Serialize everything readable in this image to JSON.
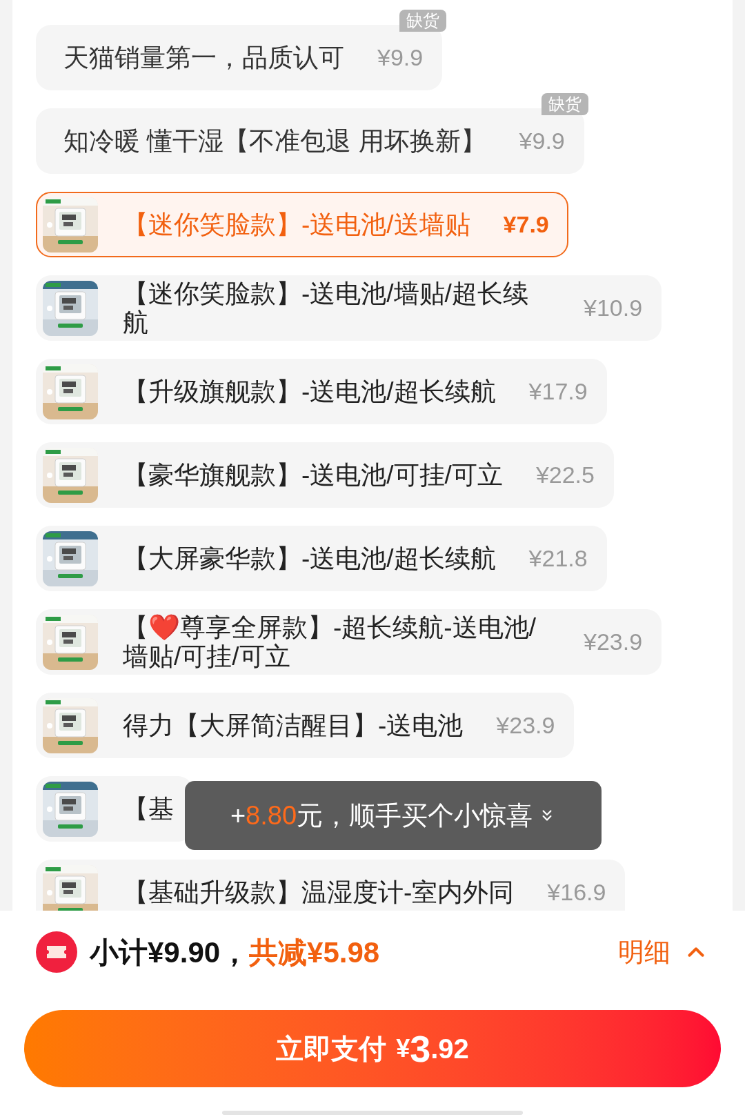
{
  "options": [
    {
      "kind": "text",
      "title": "天猫销量第一，品质认可",
      "price": "¥9.9",
      "selected": false,
      "out_of_stock": true,
      "badge": "缺货"
    },
    {
      "kind": "text",
      "title": "知冷暖 懂干湿【不准包退 用坏换新】",
      "price": "¥9.9",
      "selected": false,
      "out_of_stock": true,
      "badge": "缺货"
    },
    {
      "title": "【迷你笑脸款】-送电池/送墙贴",
      "price": "¥7.9",
      "selected": true,
      "out_of_stock": false
    },
    {
      "title": "【迷你笑脸款】-送电池/墙贴/超长续航",
      "price": "¥10.9",
      "selected": false,
      "out_of_stock": false
    },
    {
      "title": "【升级旗舰款】-送电池/超长续航",
      "price": "¥17.9",
      "selected": false,
      "out_of_stock": false
    },
    {
      "title": "【豪华旗舰款】-送电池/可挂/可立",
      "price": "¥22.5",
      "selected": false,
      "out_of_stock": false
    },
    {
      "title": "【大屏豪华款】-送电池/超长续航",
      "price": "¥21.8",
      "selected": false,
      "out_of_stock": false
    },
    {
      "title": "【❤️尊享全屏款】-超长续航-送电池/墙贴/可挂/可立",
      "price": "¥23.9",
      "selected": false,
      "out_of_stock": false
    },
    {
      "title": "得力【大屏简洁醒目】-送电池",
      "price": "¥23.9",
      "selected": false,
      "out_of_stock": false
    },
    {
      "title": "【基",
      "selected": false,
      "out_of_stock": false
    },
    {
      "title": "【基础升级款】温湿度计-室内外同",
      "price": "¥16.9",
      "selected": false,
      "out_of_stock": false
    }
  ],
  "toast": {
    "prefix": "+",
    "amount": "8.80",
    "text": "元，顺手买个小惊喜"
  },
  "summary": {
    "subtotal": "小计¥9.90，",
    "discount": "共减¥5.98",
    "details_link": "明细"
  },
  "pay_button": {
    "label": "立即支付",
    "currency": "¥",
    "integer": "3",
    "decimals": ".92"
  }
}
